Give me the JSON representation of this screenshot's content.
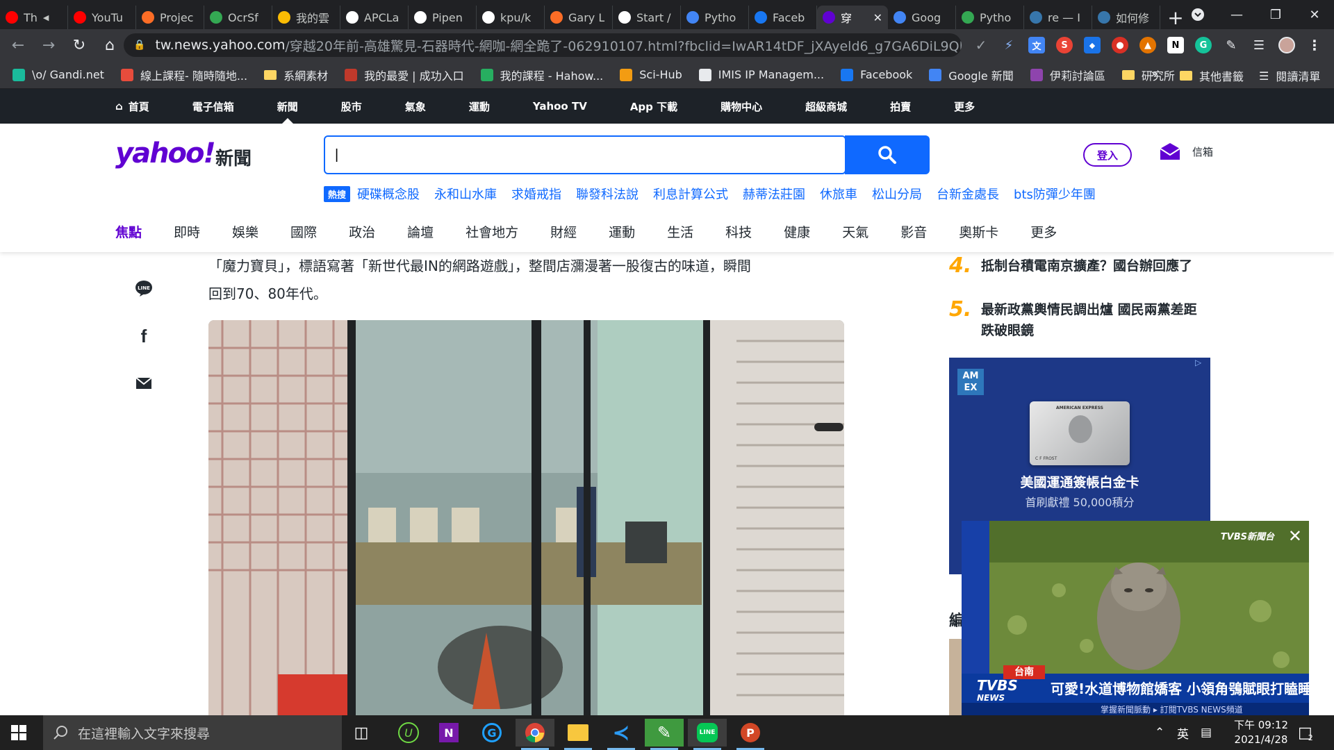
{
  "browser": {
    "tabs": [
      {
        "title": "Th",
        "fav": "youtube-icon",
        "color": "#ff0000",
        "audio": true
      },
      {
        "title": "YouTu",
        "fav": "youtube-icon",
        "color": "#ff0000"
      },
      {
        "title": "Projec",
        "fav": "gitlab-icon",
        "color": "#fc6d26"
      },
      {
        "title": "OcrSf",
        "fav": "ocr-icon",
        "color": "#34a853"
      },
      {
        "title": "我的雲",
        "fav": "google-drive-icon",
        "color": "#fbbc04"
      },
      {
        "title": "APCLa",
        "fav": "github-icon",
        "color": "#ffffff"
      },
      {
        "title": "Pipen",
        "fav": "medium-icon",
        "color": "#ffffff"
      },
      {
        "title": "kpu/k",
        "fav": "github-icon",
        "color": "#ffffff"
      },
      {
        "title": "Gary L",
        "fav": "gitlab-icon",
        "color": "#fc6d26"
      },
      {
        "title": "Start /",
        "fav": "start-icon",
        "color": "#ffffff"
      },
      {
        "title": "Pytho",
        "fav": "doc-icon",
        "color": "#4285f4"
      },
      {
        "title": "Faceb",
        "fav": "facebook-icon",
        "color": "#1877f2"
      },
      {
        "title": "穿",
        "fav": "yahoo-icon",
        "color": "#6001d2",
        "active": true
      },
      {
        "title": "Goog",
        "fav": "google-news-icon",
        "color": "#4285f4"
      },
      {
        "title": "Pytho",
        "fav": "colab-icon",
        "color": "#34a853"
      },
      {
        "title": "re — I",
        "fav": "python-icon",
        "color": "#3776ab"
      },
      {
        "title": "如何修",
        "fav": "python-icon",
        "color": "#3776ab"
      }
    ],
    "url_host": "tw.news.yahoo.com",
    "url_path": "/穿越20年前-高雄驚見-石器時代-網咖-網全跪了-062910107.html?fbclid=IwAR14tDF_jXAyeld6_g7GA6DiL9QLxHm8N...",
    "bookmarks": [
      {
        "label": "\\o/ Gandi.net",
        "icon": "gandi-icon",
        "color": "#1abc9c"
      },
      {
        "label": "線上課程- 隨時隨地...",
        "icon": "course-icon",
        "color": "#e74c3c"
      },
      {
        "label": "系網素材",
        "icon": "folder-icon",
        "color": "#fdd663"
      },
      {
        "label": "我的最愛 | 成功入口",
        "icon": "portal-icon",
        "color": "#c0392b"
      },
      {
        "label": "我的課程 - Hahow...",
        "icon": "hahow-icon",
        "color": "#27ae60"
      },
      {
        "label": "Sci-Hub",
        "icon": "scihub-icon",
        "color": "#f39c12"
      },
      {
        "label": "IMIS IP Managem...",
        "icon": "globe-icon",
        "color": "#e8eaed"
      },
      {
        "label": "Facebook",
        "icon": "facebook-icon",
        "color": "#1877f2"
      },
      {
        "label": "Google 新聞",
        "icon": "google-news-icon",
        "color": "#4285f4"
      },
      {
        "label": "伊莉討論區",
        "icon": "forum-icon",
        "color": "#8e44ad"
      },
      {
        "label": "研究所",
        "icon": "folder-icon",
        "color": "#fdd663"
      }
    ],
    "bookmarks_overflow": "»",
    "other_bookmarks": "其他書籤",
    "reading_list": "閱讀清單"
  },
  "yahoo": {
    "topnav": [
      "首頁",
      "電子信箱",
      "新聞",
      "股市",
      "氣象",
      "運動",
      "Yahoo TV",
      "App 下載",
      "購物中心",
      "超級商城",
      "拍賣",
      "更多"
    ],
    "logo": "yahoo!",
    "logo_sub": "新聞",
    "search_value": "|",
    "login": "登入",
    "mail": "信箱",
    "hot_label": "熱搜",
    "trending": [
      "硬碟概念股",
      "永和山水庫",
      "求婚戒指",
      "聯發科法說",
      "利息計算公式",
      "赫蒂法莊園",
      "休旅車",
      "松山分局",
      "台新金處長",
      "bts防彈少年團"
    ],
    "categories": [
      "焦點",
      "即時",
      "娛樂",
      "國際",
      "政治",
      "論壇",
      "社會地方",
      "財經",
      "運動",
      "生活",
      "科技",
      "健康",
      "天氣",
      "影音",
      "奧斯卡",
      "更多"
    ]
  },
  "article": {
    "line1": "「魔力寶貝」，標語寫著「新世代最IN的網路遊戲」，整間店瀰漫著一股復古的味道，瞬間",
    "line2": "回到70、80年代。"
  },
  "rail": {
    "rank4_num": "4.",
    "rank4": "抵制台積電南京擴產？國台辦回應了",
    "rank5_num": "5.",
    "rank5_l1": "最新政黨輿情民調出爐 國民兩黨差距",
    "rank5_l2": "跌破眼鏡",
    "ad_card_brand": "AMERICAN EXPRESS",
    "ad_card_name": "C F FROST",
    "ad_title": "美國運通簽帳白金卡",
    "ad_sub": "首刷獻禮 50,000積分",
    "ad_logo_l1": "AM",
    "ad_logo_l2": "EX",
    "partial": "編",
    "video_caption": "可愛!水道博物館嬌客 小領角鴞賦眼打瞌睡",
    "video_location": "台南",
    "video_ticker": "掌握新聞脈動 ▸ 訂閱TVBS NEWS頻道",
    "video_logo": "TVBS",
    "video_logo_sub": "NEWS",
    "video_watermark": "TVBS新聞台"
  },
  "taskbar": {
    "search_placeholder": "在這裡輸入文字來搜尋",
    "ime": "英",
    "time": "下午 09:12",
    "date": "2021/4/28",
    "notif_count": "2"
  }
}
